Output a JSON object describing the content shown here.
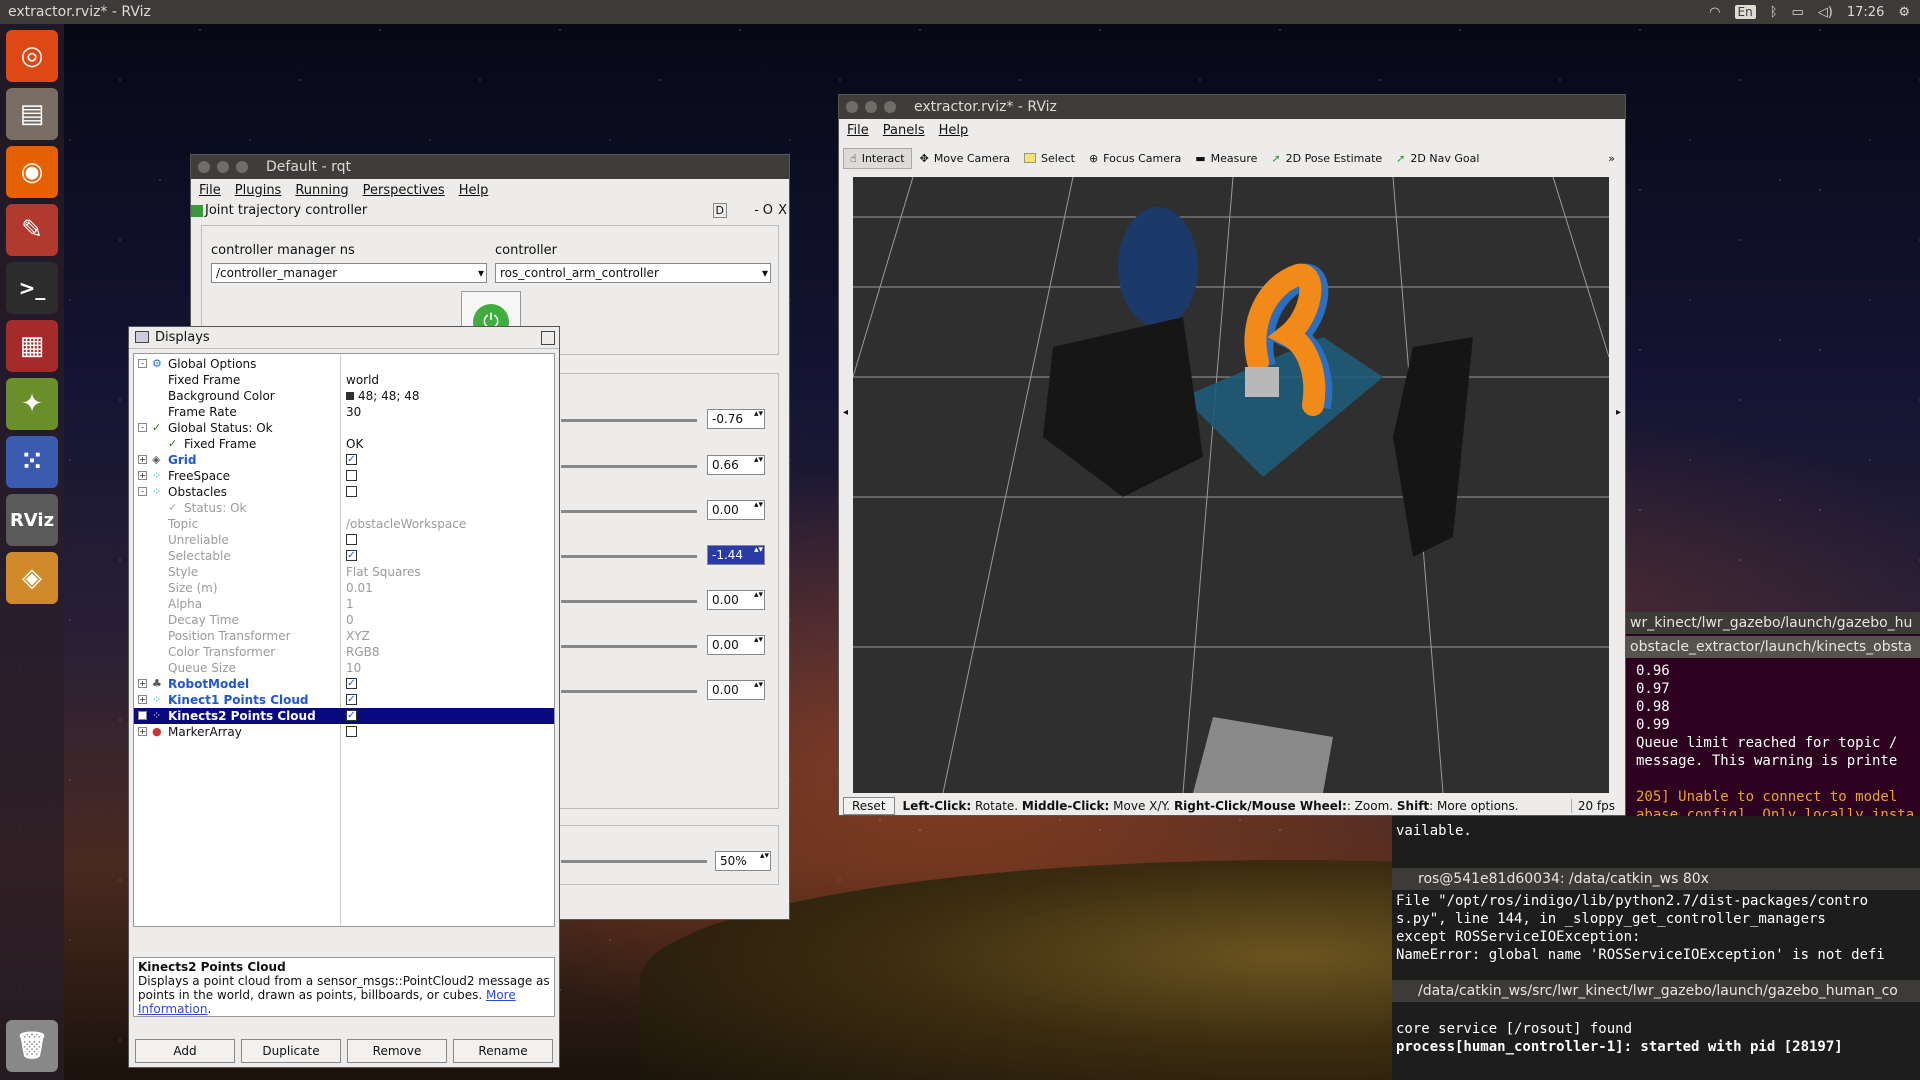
{
  "topbar": {
    "title": "extractor.rviz* - RViz",
    "lang": "En",
    "time": "17:26"
  },
  "launcher": {
    "items": [
      "ubuntu-icon",
      "files-icon",
      "firefox-icon",
      "settings-icon",
      "terminal-icon",
      "monitor-icon",
      "network-icon",
      "apps-icon",
      "rviz-icon",
      "box-icon",
      "trash-icon"
    ],
    "rviz_label": "RViz"
  },
  "rqt": {
    "title": "Default - rqt",
    "menu": [
      "File",
      "Plugins",
      "Running",
      "Perspectives",
      "Help"
    ],
    "plugin_title": "Joint trajectory controller",
    "plugin_controls": [
      "D",
      "-",
      "O",
      "X"
    ],
    "cm_label": "controller manager ns",
    "cm_value": "/controller_manager",
    "ctrl_label": "controller",
    "ctrl_value": "ros_control_arm_controller",
    "joints": [
      "-0.76",
      "0.66",
      "0.00",
      "-1.44",
      "0.00",
      "0.00",
      "0.00"
    ],
    "speed": "50%"
  },
  "displays": {
    "title": "Displays",
    "rows": [
      {
        "label": "Global Options",
        "value": ""
      },
      {
        "label": "Fixed Frame",
        "value": "world"
      },
      {
        "label": "Background Color",
        "value": "48; 48; 48"
      },
      {
        "label": "Frame Rate",
        "value": "30"
      },
      {
        "label": "Global Status: Ok",
        "value": ""
      },
      {
        "label": "Fixed Frame",
        "value": "OK"
      },
      {
        "label": "Grid",
        "value": ""
      },
      {
        "label": "FreeSpace",
        "value": ""
      },
      {
        "label": "Obstacles",
        "value": ""
      },
      {
        "label": "Status: Ok",
        "value": ""
      },
      {
        "label": "Topic",
        "value": "/obstacleWorkspace"
      },
      {
        "label": "Unreliable",
        "value": ""
      },
      {
        "label": "Selectable",
        "value": ""
      },
      {
        "label": "Style",
        "value": "Flat Squares"
      },
      {
        "label": "Size (m)",
        "value": "0.01"
      },
      {
        "label": "Alpha",
        "value": "1"
      },
      {
        "label": "Decay Time",
        "value": "0"
      },
      {
        "label": "Position Transformer",
        "value": "XYZ"
      },
      {
        "label": "Color Transformer",
        "value": "RGB8"
      },
      {
        "label": "Queue Size",
        "value": "10"
      },
      {
        "label": "RobotModel",
        "value": ""
      },
      {
        "label": "Kinect1 Points Cloud",
        "value": ""
      },
      {
        "label": "Kinects2 Points Cloud",
        "value": ""
      },
      {
        "label": "MarkerArray",
        "value": ""
      }
    ],
    "desc_title": "Kinects2 Points Cloud",
    "desc_text": "Displays a point cloud from a sensor_msgs::PointCloud2 message as points in the world, drawn as points, billboards, or cubes.",
    "desc_link": "More Information",
    "buttons": [
      "Add",
      "Duplicate",
      "Remove",
      "Rename"
    ]
  },
  "rviz": {
    "title": "extractor.rviz* - RViz",
    "menu": [
      "File",
      "Panels",
      "Help"
    ],
    "tools": [
      "Interact",
      "Move Camera",
      "Select",
      "Focus Camera",
      "Measure",
      "2D Pose Estimate",
      "2D Nav Goal"
    ],
    "reset": "Reset",
    "status": {
      "lc": "Left-Click:",
      "lc_t": " Rotate. ",
      "mc": "Middle-Click:",
      "mc_t": " Move X/Y. ",
      "rc": "Right-Click/Mouse Wheel:",
      "rc_t": ": Zoom. ",
      "sh": "Shift",
      "sh_t": ": More options."
    },
    "fps": "20 fps"
  },
  "terminal1": {
    "tab1": "wr_kinect/lwr_gazebo/launch/gazebo_hu",
    "tab2": "obstacle_extractor/launch/kinects_obsta",
    "lines": [
      "0.96",
      "0.97",
      "0.98",
      "0.99",
      "Queue limit reached for topic /",
      "message. This warning is printe",
      "205] Unable to connect to model ",
      "abase.config]. Only locally insta",
      "vailable."
    ]
  },
  "terminal2": {
    "tab1": "ros@541e81d60034: /data/catkin_ws 80x",
    "lines": [
      "  File \"/opt/ros/indigo/lib/python2.7/dist-packages/contro",
      "s.py\", line 144, in _sloppy_get_controller_managers",
      "    except ROSServiceIOException:",
      "NameError: global name 'ROSServiceIOException' is not defi"
    ],
    "tab2": "/data/catkin_ws/src/lwr_kinect/lwr_gazebo/launch/gazebo_human_co",
    "lines2": [
      "core service [/rosout] found",
      "process[human_controller-1]: started with pid [28197]"
    ]
  }
}
